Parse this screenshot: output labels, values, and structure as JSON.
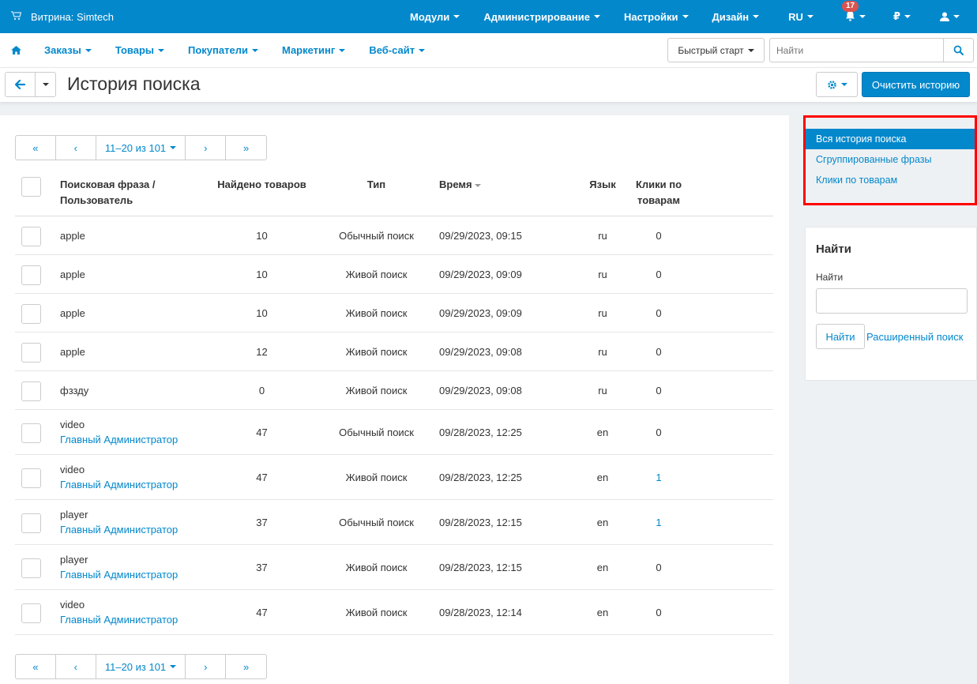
{
  "topbar": {
    "store_label": "Витрина: Simtech",
    "menu": [
      "Модули",
      "Администрирование",
      "Настройки",
      "Дизайн",
      "RU"
    ],
    "notifications_count": "17",
    "currency": "₽"
  },
  "navbar": {
    "items": [
      "Заказы",
      "Товары",
      "Покупатели",
      "Маркетинг",
      "Веб-сайт"
    ],
    "quickstart": "Быстрый старт",
    "search_placeholder": "Найти"
  },
  "titlebar": {
    "title": "История поиска",
    "clear_button": "Очистить историю"
  },
  "pager": {
    "first": "«",
    "prev": "‹",
    "range": "11–20 из 101",
    "next": "›",
    "last": "»"
  },
  "table": {
    "headers": {
      "phrase": "Поисковая фраза /",
      "phrase2": "Пользователь",
      "found": "Найдено товаров",
      "type": "Тип",
      "time": "Время",
      "lang": "Язык",
      "clicks": "Клики по",
      "clicks2": "товарам"
    },
    "rows": [
      {
        "phrase": "apple",
        "user": "",
        "found": "10",
        "type": "Обычный поиск",
        "time": "09/29/2023, 09:15",
        "lang": "ru",
        "clicks": "0"
      },
      {
        "phrase": "apple",
        "user": "",
        "found": "10",
        "type": "Живой поиск",
        "time": "09/29/2023, 09:09",
        "lang": "ru",
        "clicks": "0"
      },
      {
        "phrase": "apple",
        "user": "",
        "found": "10",
        "type": "Живой поиск",
        "time": "09/29/2023, 09:09",
        "lang": "ru",
        "clicks": "0"
      },
      {
        "phrase": "apple",
        "user": "",
        "found": "12",
        "type": "Живой поиск",
        "time": "09/29/2023, 09:08",
        "lang": "ru",
        "clicks": "0"
      },
      {
        "phrase": "фзздy",
        "user": "",
        "found": "0",
        "type": "Живой поиск",
        "time": "09/29/2023, 09:08",
        "lang": "ru",
        "clicks": "0"
      },
      {
        "phrase": "video",
        "user": "Главный Администратор",
        "found": "47",
        "type": "Обычный поиск",
        "time": "09/28/2023, 12:25",
        "lang": "en",
        "clicks": "0"
      },
      {
        "phrase": "video",
        "user": "Главный Администратор",
        "found": "47",
        "type": "Живой поиск",
        "time": "09/28/2023, 12:25",
        "lang": "en",
        "clicks": "1"
      },
      {
        "phrase": "player",
        "user": "Главный Администратор",
        "found": "37",
        "type": "Обычный поиск",
        "time": "09/28/2023, 12:15",
        "lang": "en",
        "clicks": "1"
      },
      {
        "phrase": "player",
        "user": "Главный Администратор",
        "found": "37",
        "type": "Живой поиск",
        "time": "09/28/2023, 12:15",
        "lang": "en",
        "clicks": "0"
      },
      {
        "phrase": "video",
        "user": "Главный Администратор",
        "found": "47",
        "type": "Живой поиск",
        "time": "09/28/2023, 12:14",
        "lang": "en",
        "clicks": "0"
      }
    ]
  },
  "sidebar": {
    "nav": [
      "Вся история поиска",
      "Сгруппированные фразы",
      "Клики по товарам"
    ],
    "search": {
      "heading": "Найти",
      "label": "Найти",
      "button": "Найти",
      "advanced": "Расширенный поиск"
    }
  },
  "colors": {
    "primary": "#0388cc",
    "highlight": "#ff0000",
    "badge": "#d9534f"
  }
}
